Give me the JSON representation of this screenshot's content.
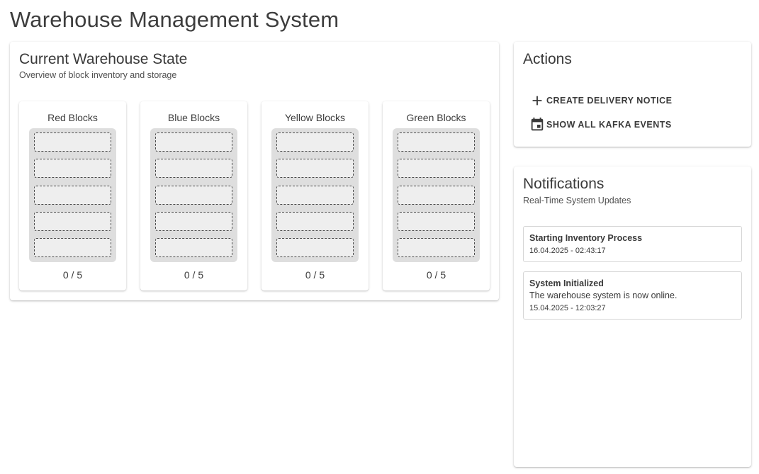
{
  "page": {
    "title": "Warehouse Management System"
  },
  "state": {
    "title": "Current Warehouse State",
    "subtitle": "Overview of block inventory and storage",
    "blocks": [
      {
        "name": "Red Blocks",
        "count": "0 / 5"
      },
      {
        "name": "Blue Blocks",
        "count": "0 / 5"
      },
      {
        "name": "Yellow Blocks",
        "count": "0 / 5"
      },
      {
        "name": "Green Blocks",
        "count": "0 / 5"
      }
    ]
  },
  "actions": {
    "title": "Actions",
    "create_label": "CREATE DELIVERY NOTICE",
    "create_icon": "plus-icon",
    "events_label": "SHOW ALL KAFKA EVENTS",
    "events_icon": "calendar-icon"
  },
  "notifications": {
    "title": "Notifications",
    "subtitle": "Real-Time System Updates",
    "items": [
      {
        "title": "Starting Inventory Process",
        "message": "",
        "time": "16.04.2025 - 02:43:17"
      },
      {
        "title": "System Initialized",
        "message": "The warehouse system is now online.",
        "time": "15.04.2025 - 12:03:27"
      }
    ]
  }
}
